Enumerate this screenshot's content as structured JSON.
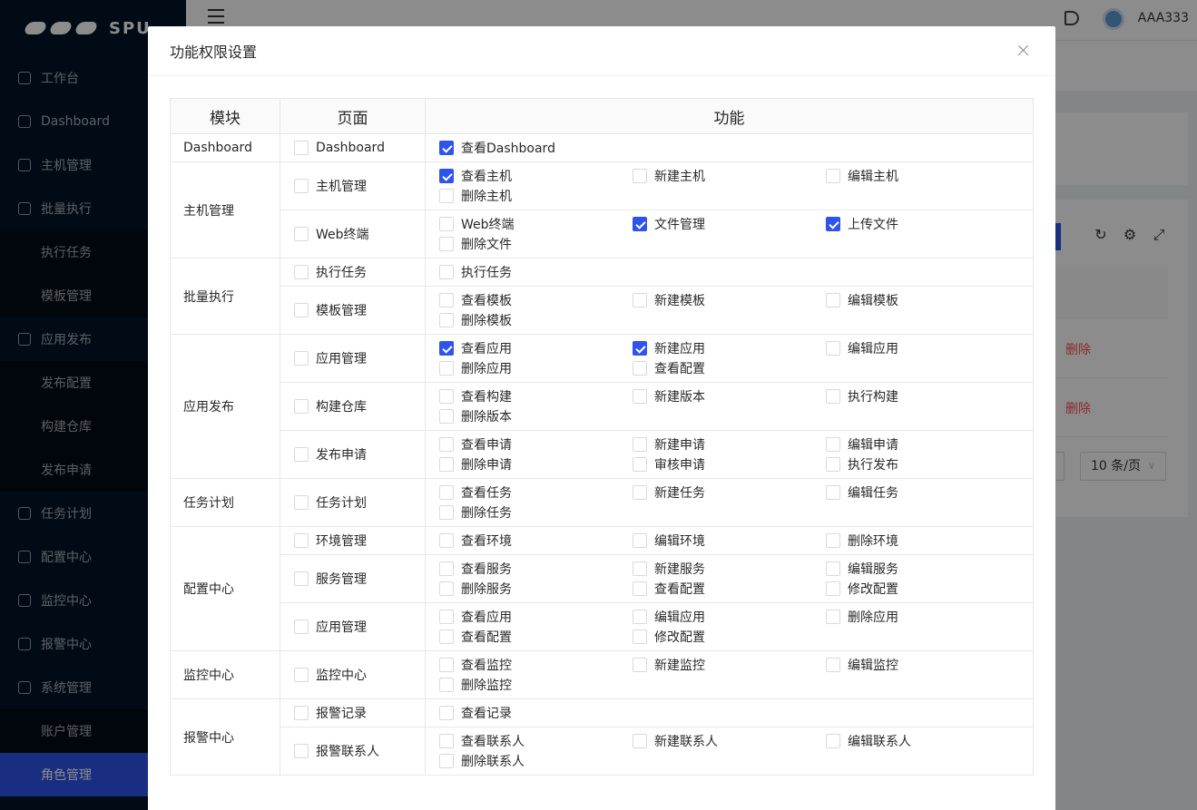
{
  "app": {
    "logo_text": "SPU",
    "username": "AAA333"
  },
  "sidebar": {
    "items": [
      {
        "label": "工作台",
        "type": "top",
        "icon": "desktop-icon"
      },
      {
        "label": "Dashboard",
        "type": "top",
        "icon": "dashboard-icon"
      },
      {
        "label": "主机管理",
        "type": "top",
        "icon": "cloud-server-icon"
      },
      {
        "label": "批量执行",
        "type": "top",
        "icon": "code-icon"
      },
      {
        "label": "执行任务",
        "type": "sub"
      },
      {
        "label": "模板管理",
        "type": "sub"
      },
      {
        "label": "应用发布",
        "type": "top",
        "icon": "flag-icon"
      },
      {
        "label": "发布配置",
        "type": "sub"
      },
      {
        "label": "构建仓库",
        "type": "sub"
      },
      {
        "label": "发布申请",
        "type": "sub"
      },
      {
        "label": "任务计划",
        "type": "top",
        "icon": "schedule-icon"
      },
      {
        "label": "配置中心",
        "type": "top",
        "icon": "deployment-icon"
      },
      {
        "label": "监控中心",
        "type": "top",
        "icon": "monitor-icon"
      },
      {
        "label": "报警中心",
        "type": "top",
        "icon": "alert-icon"
      },
      {
        "label": "系统管理",
        "type": "top",
        "icon": "setting-icon"
      },
      {
        "label": "账户管理",
        "type": "sub"
      },
      {
        "label": "角色管理",
        "type": "sub",
        "active": true
      }
    ]
  },
  "background": {
    "delete_label": "删除",
    "page_size": "10 条/页"
  },
  "modal": {
    "title": "功能权限设置",
    "headers": {
      "module": "模块",
      "page": "页面",
      "function": "功能"
    },
    "accent_color": "#2f54eb",
    "modules": [
      {
        "name": "Dashboard",
        "pages": [
          {
            "name": "Dashboard",
            "checked": false,
            "functions": [
              {
                "label": "查看Dashboard",
                "checked": true
              }
            ]
          }
        ]
      },
      {
        "name": "主机管理",
        "pages": [
          {
            "name": "主机管理",
            "checked": false,
            "functions": [
              {
                "label": "查看主机",
                "checked": true
              },
              {
                "label": "新建主机",
                "checked": false
              },
              {
                "label": "编辑主机",
                "checked": false
              },
              {
                "label": "删除主机",
                "checked": false
              }
            ]
          },
          {
            "name": "Web终端",
            "checked": false,
            "functions": [
              {
                "label": "Web终端",
                "checked": false
              },
              {
                "label": "文件管理",
                "checked": true
              },
              {
                "label": "上传文件",
                "checked": true
              },
              {
                "label": "删除文件",
                "checked": false
              }
            ]
          }
        ]
      },
      {
        "name": "批量执行",
        "pages": [
          {
            "name": "执行任务",
            "checked": false,
            "functions": [
              {
                "label": "执行任务",
                "checked": false
              }
            ]
          },
          {
            "name": "模板管理",
            "checked": false,
            "functions": [
              {
                "label": "查看模板",
                "checked": false
              },
              {
                "label": "新建模板",
                "checked": false
              },
              {
                "label": "编辑模板",
                "checked": false
              },
              {
                "label": "删除模板",
                "checked": false
              }
            ]
          }
        ]
      },
      {
        "name": "应用发布",
        "pages": [
          {
            "name": "应用管理",
            "checked": false,
            "functions": [
              {
                "label": "查看应用",
                "checked": true
              },
              {
                "label": "新建应用",
                "checked": true
              },
              {
                "label": "编辑应用",
                "checked": false
              },
              {
                "label": "删除应用",
                "checked": false
              },
              {
                "label": "查看配置",
                "checked": false
              }
            ]
          },
          {
            "name": "构建仓库",
            "checked": false,
            "functions": [
              {
                "label": "查看构建",
                "checked": false
              },
              {
                "label": "新建版本",
                "checked": false
              },
              {
                "label": "执行构建",
                "checked": false
              },
              {
                "label": "删除版本",
                "checked": false
              }
            ]
          },
          {
            "name": "发布申请",
            "checked": false,
            "functions": [
              {
                "label": "查看申请",
                "checked": false
              },
              {
                "label": "新建申请",
                "checked": false
              },
              {
                "label": "编辑申请",
                "checked": false
              },
              {
                "label": "删除申请",
                "checked": false
              },
              {
                "label": "审核申请",
                "checked": false
              },
              {
                "label": "执行发布",
                "checked": false
              }
            ]
          }
        ]
      },
      {
        "name": "任务计划",
        "pages": [
          {
            "name": "任务计划",
            "checked": false,
            "functions": [
              {
                "label": "查看任务",
                "checked": false
              },
              {
                "label": "新建任务",
                "checked": false
              },
              {
                "label": "编辑任务",
                "checked": false
              },
              {
                "label": "删除任务",
                "checked": false
              }
            ]
          }
        ]
      },
      {
        "name": "配置中心",
        "pages": [
          {
            "name": "环境管理",
            "checked": false,
            "functions": [
              {
                "label": "查看环境",
                "checked": false
              },
              {
                "label": "编辑环境",
                "checked": false
              },
              {
                "label": "删除环境",
                "checked": false
              }
            ]
          },
          {
            "name": "服务管理",
            "checked": false,
            "functions": [
              {
                "label": "查看服务",
                "checked": false
              },
              {
                "label": "新建服务",
                "checked": false
              },
              {
                "label": "编辑服务",
                "checked": false
              },
              {
                "label": "删除服务",
                "checked": false
              },
              {
                "label": "查看配置",
                "checked": false
              },
              {
                "label": "修改配置",
                "checked": false
              }
            ]
          },
          {
            "name": "应用管理",
            "checked": false,
            "functions": [
              {
                "label": "查看应用",
                "checked": false
              },
              {
                "label": "编辑应用",
                "checked": false
              },
              {
                "label": "删除应用",
                "checked": false
              },
              {
                "label": "查看配置",
                "checked": false
              },
              {
                "label": "修改配置",
                "checked": false
              }
            ]
          }
        ]
      },
      {
        "name": "监控中心",
        "pages": [
          {
            "name": "监控中心",
            "checked": false,
            "functions": [
              {
                "label": "查看监控",
                "checked": false
              },
              {
                "label": "新建监控",
                "checked": false
              },
              {
                "label": "编辑监控",
                "checked": false
              },
              {
                "label": "删除监控",
                "checked": false
              }
            ]
          }
        ]
      },
      {
        "name": "报警中心",
        "pages": [
          {
            "name": "报警记录",
            "checked": false,
            "functions": [
              {
                "label": "查看记录",
                "checked": false
              }
            ]
          },
          {
            "name": "报警联系人",
            "checked": false,
            "functions": [
              {
                "label": "查看联系人",
                "checked": false
              },
              {
                "label": "新建联系人",
                "checked": false
              },
              {
                "label": "编辑联系人",
                "checked": false
              },
              {
                "label": "删除联系人",
                "checked": false
              }
            ]
          }
        ]
      }
    ]
  }
}
